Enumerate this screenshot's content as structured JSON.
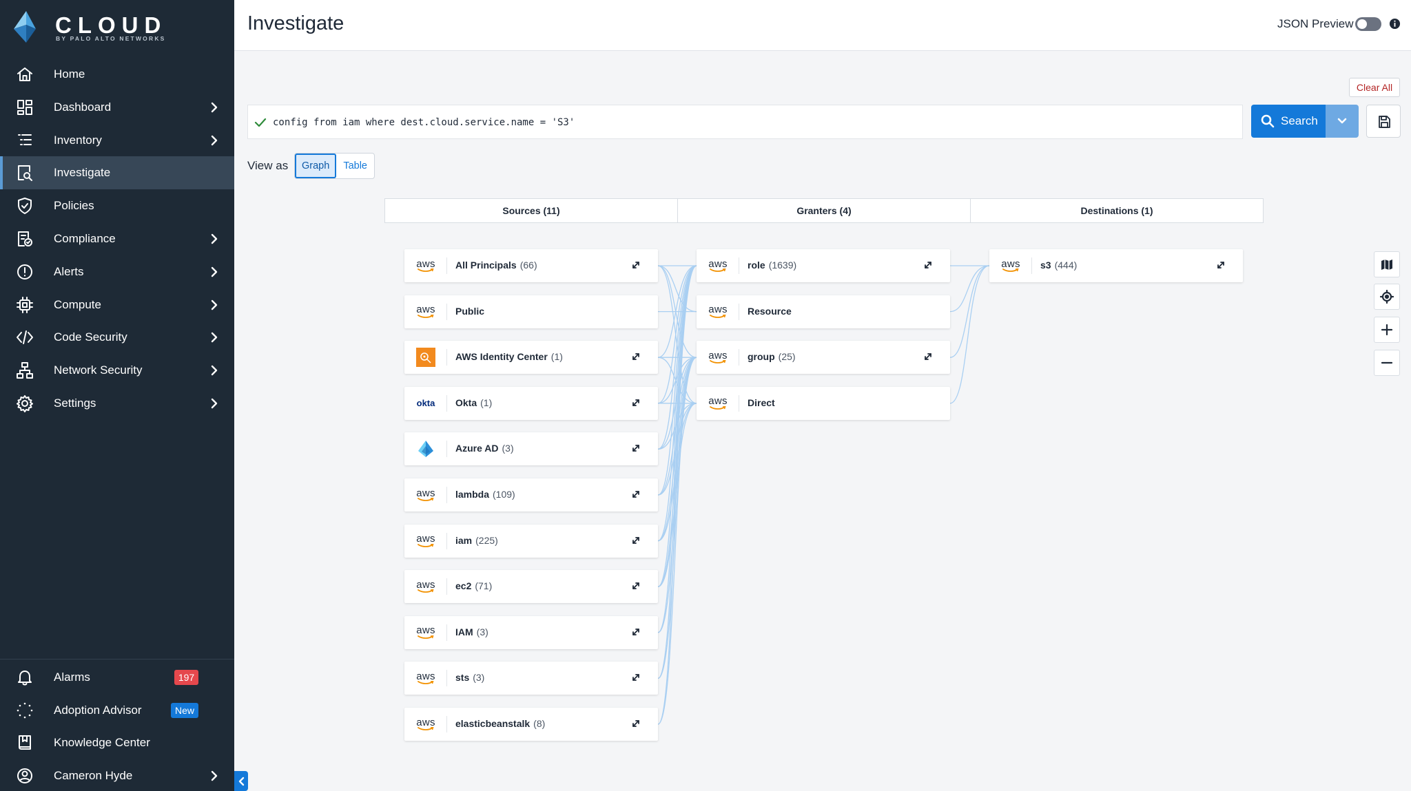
{
  "brand": {
    "name": "CLOUD",
    "subtitle": "BY PALO ALTO NETWORKS"
  },
  "colors": {
    "sidebar_bg": "#1e2a36",
    "accent": "#1479d9",
    "alarm_badge": "#e5484d",
    "edge": "#a9cff2"
  },
  "sidebar": {
    "items": [
      {
        "label": "Home",
        "icon": "home-icon",
        "has_chevron": false,
        "active": false
      },
      {
        "label": "Dashboard",
        "icon": "dashboard-icon",
        "has_chevron": true,
        "active": false
      },
      {
        "label": "Inventory",
        "icon": "inventory-list-icon",
        "has_chevron": true,
        "active": false
      },
      {
        "label": "Investigate",
        "icon": "investigate-icon",
        "has_chevron": false,
        "active": true
      },
      {
        "label": "Policies",
        "icon": "shield-check-icon",
        "has_chevron": false,
        "active": false
      },
      {
        "label": "Compliance",
        "icon": "compliance-report-icon",
        "has_chevron": true,
        "active": false
      },
      {
        "label": "Alerts",
        "icon": "alert-circle-icon",
        "has_chevron": true,
        "active": false
      },
      {
        "label": "Compute",
        "icon": "compute-chip-icon",
        "has_chevron": true,
        "active": false
      },
      {
        "label": "Code Security",
        "icon": "code-brackets-icon",
        "has_chevron": true,
        "active": false
      },
      {
        "label": "Network Security",
        "icon": "network-tree-icon",
        "has_chevron": true,
        "active": false
      },
      {
        "label": "Settings",
        "icon": "gear-icon",
        "has_chevron": true,
        "active": false
      }
    ],
    "bottom_items": [
      {
        "label": "Alarms",
        "icon": "bell-icon",
        "badge": "197"
      },
      {
        "label": "Adoption Advisor",
        "icon": "spinner-dots-icon",
        "badge": "New"
      },
      {
        "label": "Knowledge Center",
        "icon": "book-icon",
        "badge": ""
      },
      {
        "label": "Cameron Hyde",
        "icon": "user-circle-icon",
        "badge": "",
        "has_chevron": true
      }
    ]
  },
  "header": {
    "title": "Investigate",
    "json_preview_label": "JSON Preview"
  },
  "query": {
    "clear_all_label": "Clear All",
    "text": "config from iam where dest.cloud.service.name = 'S3'",
    "search_label": "Search"
  },
  "view": {
    "label": "View as",
    "options": [
      "Graph",
      "Table"
    ],
    "selected": "Graph"
  },
  "graph": {
    "columns": [
      "Sources (11)",
      "Granters (4)",
      "Destinations (1)"
    ],
    "sources": [
      {
        "name": "All Principals",
        "count": "(66)",
        "logo": "aws",
        "expandable": true
      },
      {
        "name": "Public",
        "count": "",
        "logo": "aws",
        "expandable": false
      },
      {
        "name": "AWS Identity Center",
        "count": "(1)",
        "logo": "identity-center",
        "expandable": true
      },
      {
        "name": "Okta",
        "count": "(1)",
        "logo": "okta",
        "logo_text": "okta",
        "expandable": true
      },
      {
        "name": "Azure AD",
        "count": "(3)",
        "logo": "azure",
        "expandable": true
      },
      {
        "name": "lambda",
        "count": "(109)",
        "logo": "aws",
        "expandable": true
      },
      {
        "name": "iam",
        "count": "(225)",
        "logo": "aws",
        "expandable": true
      },
      {
        "name": "ec2",
        "count": "(71)",
        "logo": "aws",
        "expandable": true
      },
      {
        "name": "IAM",
        "count": "(3)",
        "logo": "aws",
        "expandable": true
      },
      {
        "name": "sts",
        "count": "(3)",
        "logo": "aws",
        "expandable": true
      },
      {
        "name": "elasticbeanstalk",
        "count": "(8)",
        "logo": "aws",
        "expandable": true
      }
    ],
    "granters": [
      {
        "name": "role",
        "count": "(1639)",
        "logo": "aws",
        "expandable": true
      },
      {
        "name": "Resource",
        "count": "",
        "logo": "aws",
        "expandable": false
      },
      {
        "name": "group",
        "count": "(25)",
        "logo": "aws",
        "expandable": true
      },
      {
        "name": "Direct",
        "count": "",
        "logo": "aws",
        "expandable": false
      }
    ],
    "destinations": [
      {
        "name": "s3",
        "count": "(444)",
        "logo": "aws",
        "expandable": true
      }
    ],
    "aws_logo_text": "aws"
  },
  "graph_controls": [
    {
      "name": "map-icon"
    },
    {
      "name": "locate-icon"
    },
    {
      "name": "zoom-in-icon"
    },
    {
      "name": "zoom-out-icon"
    }
  ]
}
